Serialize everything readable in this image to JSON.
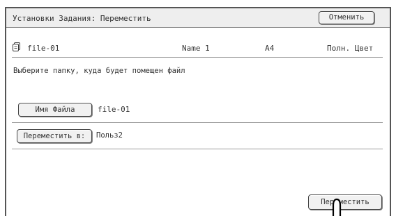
{
  "header": {
    "title": "Установки Задания: Переместить",
    "cancel_label": "Отменить"
  },
  "file_info": {
    "icon": "document-stack-icon",
    "file_name": "file-01",
    "user_name": "Name 1",
    "paper_size": "A4",
    "color_mode": "Полн. Цвет"
  },
  "instruction": "Выберите папку, куда будет помещен файл",
  "form": {
    "filename_button_label": "Имя Файла",
    "filename_value": "file-01",
    "move_to_button_label": "Переместить в:",
    "move_to_value": "Польз2"
  },
  "footer": {
    "move_button_label": "Переместить"
  },
  "colors": {
    "titlebar": "#eeeeee",
    "border": "#555555",
    "button_face": "#f1f1f1"
  }
}
